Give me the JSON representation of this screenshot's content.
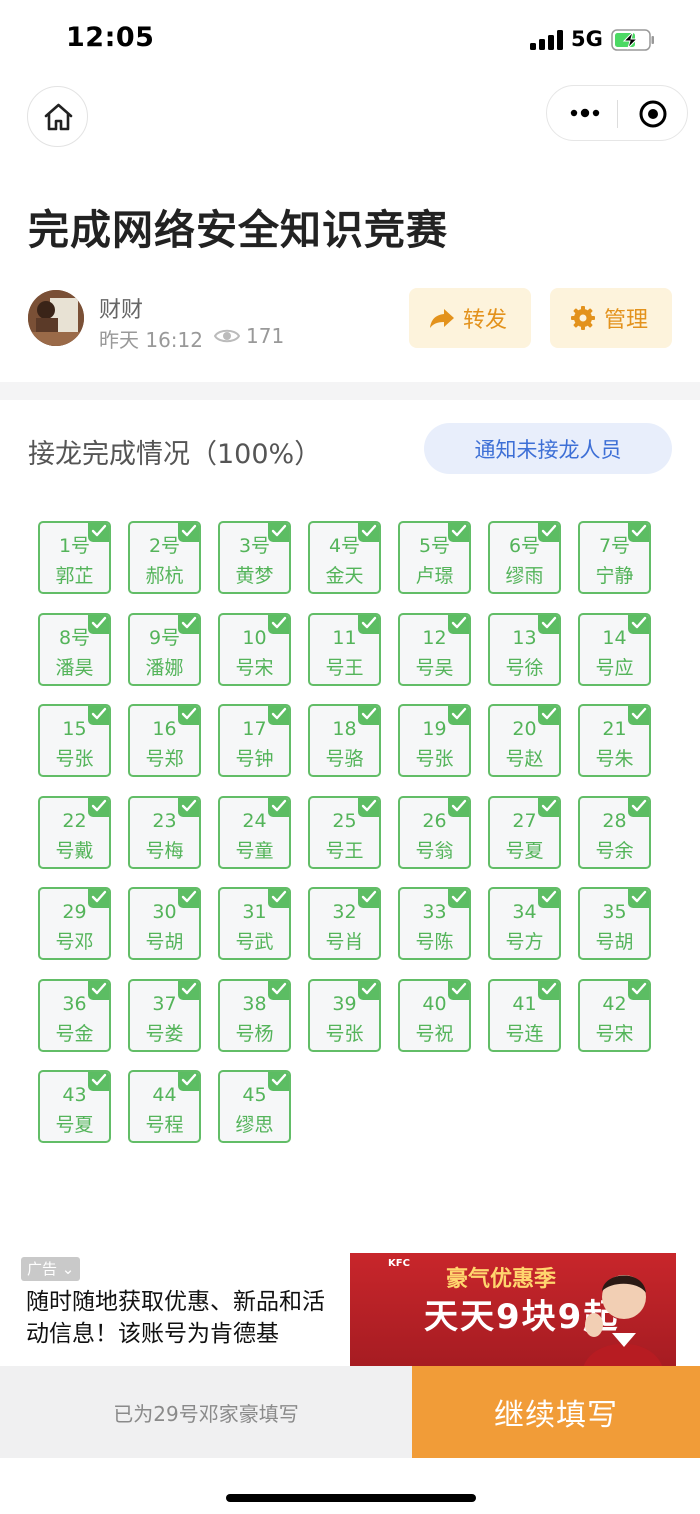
{
  "status_bar": {
    "time": "12:05",
    "network": "5G"
  },
  "page": {
    "title": "完成网络安全知识竞赛"
  },
  "author": {
    "name": "财财",
    "time": "昨天 16:12",
    "views": "171"
  },
  "actions": {
    "share_label": "转发",
    "manage_label": "管理"
  },
  "section": {
    "title": "接龙完成情况（100%）",
    "notify_label": "通知未接龙人员"
  },
  "entries": [
    {
      "text": "1号\n郭芷"
    },
    {
      "text": "2号\n郝杭"
    },
    {
      "text": "3号\n黄梦"
    },
    {
      "text": "4号\n金天"
    },
    {
      "text": "5号\n卢璟"
    },
    {
      "text": "6号\n缪雨"
    },
    {
      "text": "7号\n宁静"
    },
    {
      "text": "8号\n潘昊"
    },
    {
      "text": "9号\n潘娜"
    },
    {
      "text": "10\n号宋"
    },
    {
      "text": "11\n号王"
    },
    {
      "text": "12\n号吴"
    },
    {
      "text": "13\n号徐"
    },
    {
      "text": "14\n号应"
    },
    {
      "text": "15\n号张"
    },
    {
      "text": "16\n号郑"
    },
    {
      "text": "17\n号钟"
    },
    {
      "text": "18\n号骆"
    },
    {
      "text": "19\n号张"
    },
    {
      "text": "20\n号赵"
    },
    {
      "text": "21\n号朱"
    },
    {
      "text": "22\n号戴"
    },
    {
      "text": "23\n号梅"
    },
    {
      "text": "24\n号童"
    },
    {
      "text": "25\n号王"
    },
    {
      "text": "26\n号翁"
    },
    {
      "text": "27\n号夏"
    },
    {
      "text": "28\n号余"
    },
    {
      "text": "29\n号邓"
    },
    {
      "text": "30\n号胡"
    },
    {
      "text": "31\n号武"
    },
    {
      "text": "32\n号肖"
    },
    {
      "text": "33\n号陈"
    },
    {
      "text": "34\n号方"
    },
    {
      "text": "35\n号胡"
    },
    {
      "text": "36\n号金"
    },
    {
      "text": "37\n号娄"
    },
    {
      "text": "38\n号杨"
    },
    {
      "text": "39\n号张"
    },
    {
      "text": "40\n号祝"
    },
    {
      "text": "41\n号连"
    },
    {
      "text": "42\n号宋"
    },
    {
      "text": "43\n号夏"
    },
    {
      "text": "44\n号程"
    },
    {
      "text": "45\n缪思"
    }
  ],
  "ad": {
    "badge": "广告",
    "text": "随时随地获取优惠、新品和活动信息！该账号为肯德基",
    "image_kfc": "KFC",
    "image_headline": "豪气优惠季",
    "image_slogan": "天天9块9起"
  },
  "bottom": {
    "filled_note": "已为29号邓家豪填写",
    "continue_label": "继续填写"
  },
  "colors": {
    "accent_green": "#5cbd63",
    "accent_orange": "#f19c38",
    "link_blue": "#3d6fd6"
  }
}
